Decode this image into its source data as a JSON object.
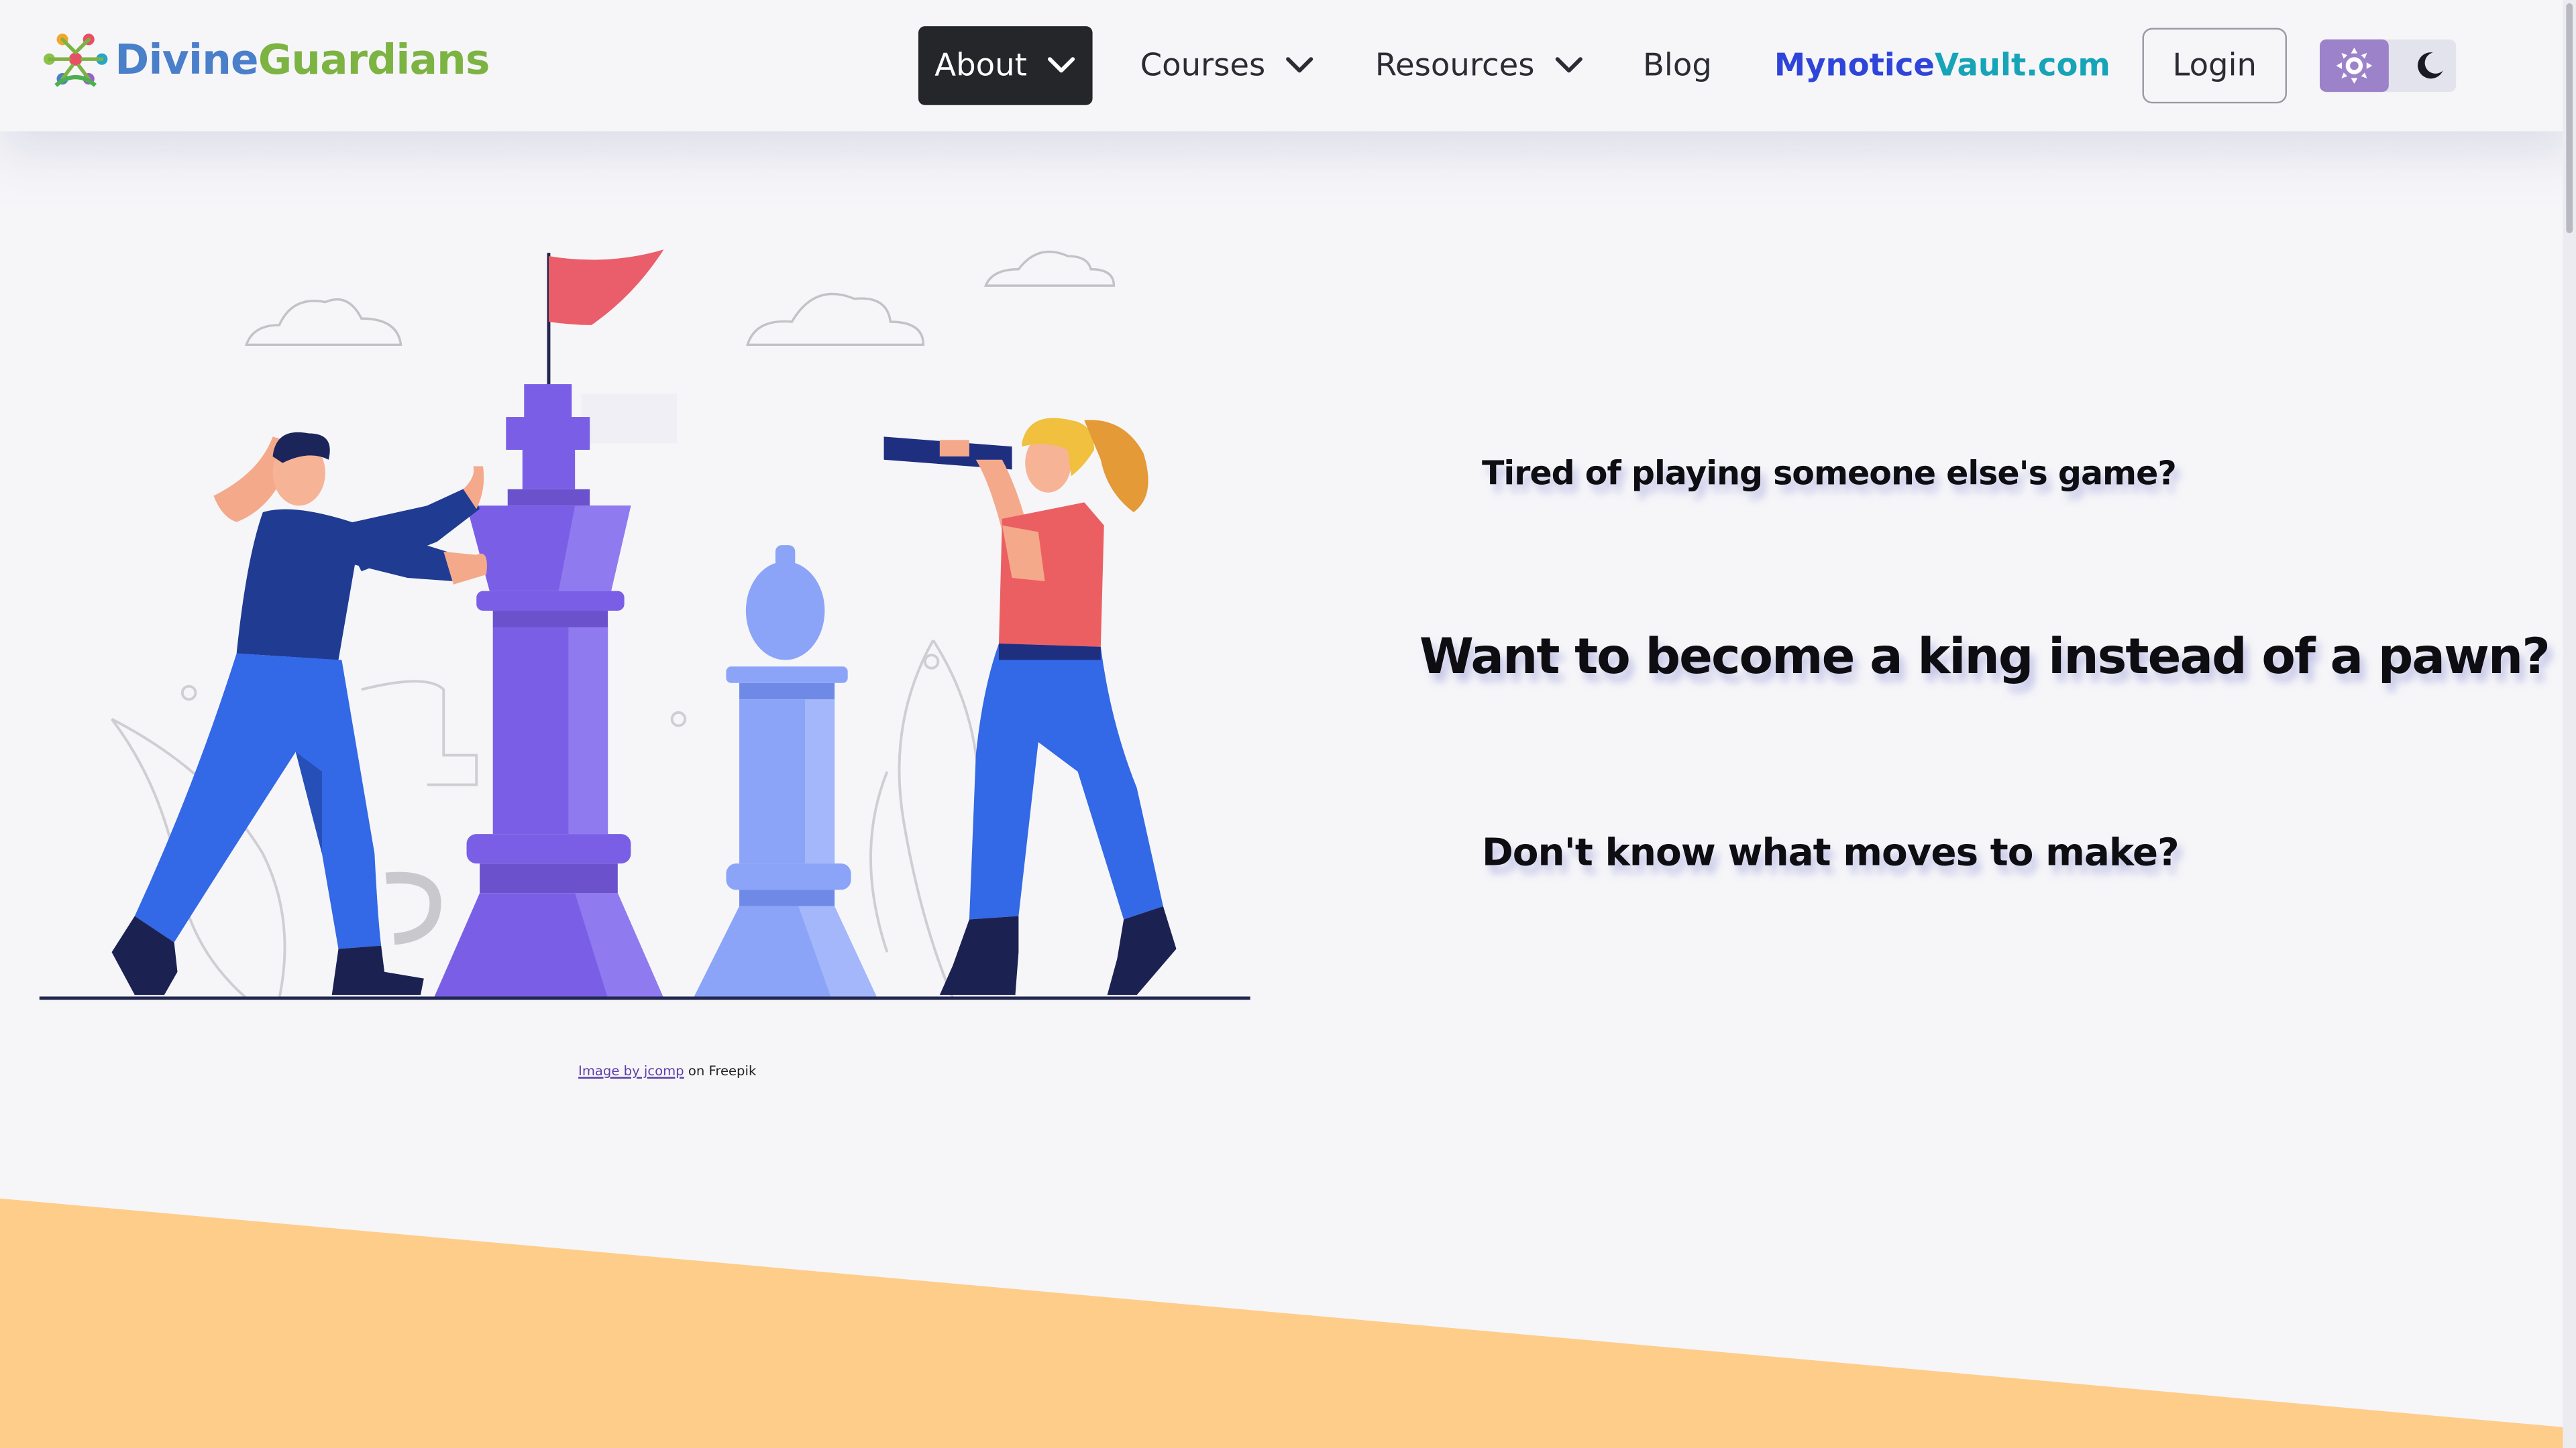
{
  "brand": {
    "name_part1": "Divine",
    "name_part2": "Guardians",
    "colors": {
      "part1": "#4a7fc9",
      "part2": "#7cb342"
    }
  },
  "nav": {
    "about": "About",
    "courses": "Courses",
    "resources": "Resources",
    "blog": "Blog",
    "vault_part1": "Mynotice",
    "vault_part2": "Vault.com",
    "login": "Login",
    "active_item": "About",
    "icons": {
      "dropdown": "chevron-down-icon",
      "light": "sun-icon",
      "dark": "moon-icon"
    }
  },
  "hero": {
    "credit_link": "Image by jcomp",
    "credit_suffix": " on Freepik",
    "taglines": [
      "Tired of playing someone else's game?",
      "Want to become a king instead of a pawn?",
      "Don't know what moves to make?"
    ]
  },
  "colors": {
    "background": "#f6f6f9",
    "accent_wave": "#ffcd8a",
    "active_nav_bg": "#25262a",
    "theme_active": "#9b82c9"
  }
}
